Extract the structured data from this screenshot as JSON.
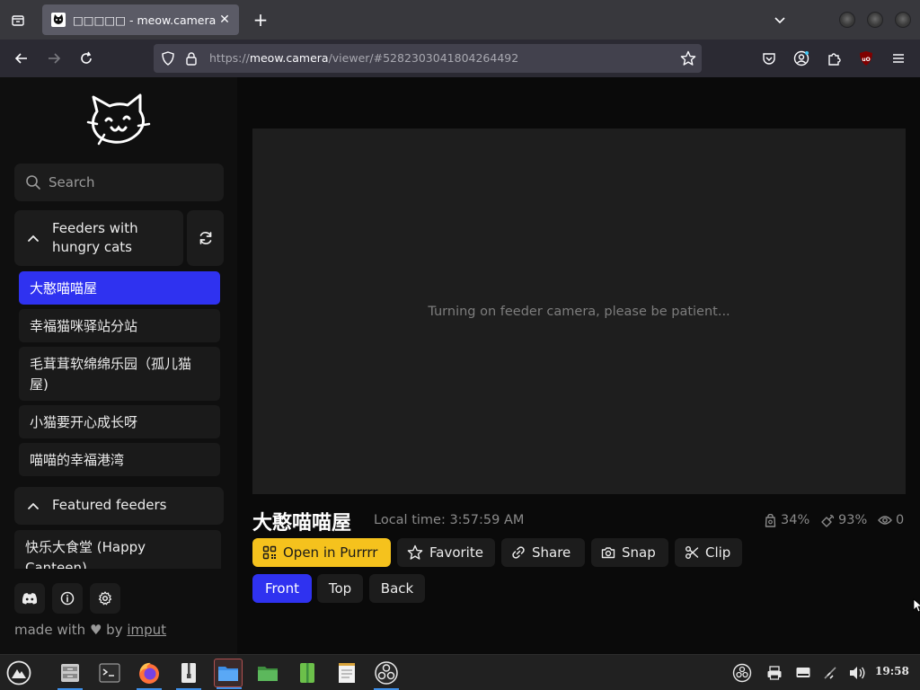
{
  "browser": {
    "tab_title": "□□□□□ - meow.camera",
    "url_scheme": "https://",
    "url_host": "meow.camera",
    "url_path": "/viewer/#5282303041804264492",
    "clock": "19:58"
  },
  "sidebar": {
    "search_placeholder": "Search",
    "groups": [
      {
        "label": "Feeders with hungry cats"
      },
      {
        "label": "Featured feeders"
      }
    ],
    "hungry_feeders": [
      {
        "name": "大憨喵喵屋",
        "active": true
      },
      {
        "name": "幸福猫咪驿站分站",
        "active": false
      },
      {
        "name": "毛茸茸软绵绵乐园（孤儿猫屋)",
        "active": false
      },
      {
        "name": "小猫要开心成长呀",
        "active": false
      },
      {
        "name": "喵喵的幸福港湾",
        "active": false
      }
    ],
    "featured_feeders": [
      {
        "name": "快乐大食堂 (Happy Canteen)"
      }
    ],
    "footer": {
      "made_with": "made with",
      "heart": "♥",
      "by": "by",
      "author": "imput"
    }
  },
  "viewer": {
    "status_message": "Turning on feeder camera, please be patient..."
  },
  "camera": {
    "title": "大憨喵喵屋",
    "local_time": "Local time: 3:57:59 AM",
    "food_level": "34%",
    "battery_level": "93%",
    "viewers": "0"
  },
  "actions": {
    "open_in_purrrr": "Open in Purrrr",
    "favorite": "Favorite",
    "share": "Share",
    "snap": "Snap",
    "clip": "Clip"
  },
  "views": {
    "front": "Front",
    "top": "Top",
    "back": "Back",
    "active": "Front"
  },
  "colors": {
    "accent_blue": "#2f32f0",
    "accent_yellow": "#f5c21d"
  }
}
